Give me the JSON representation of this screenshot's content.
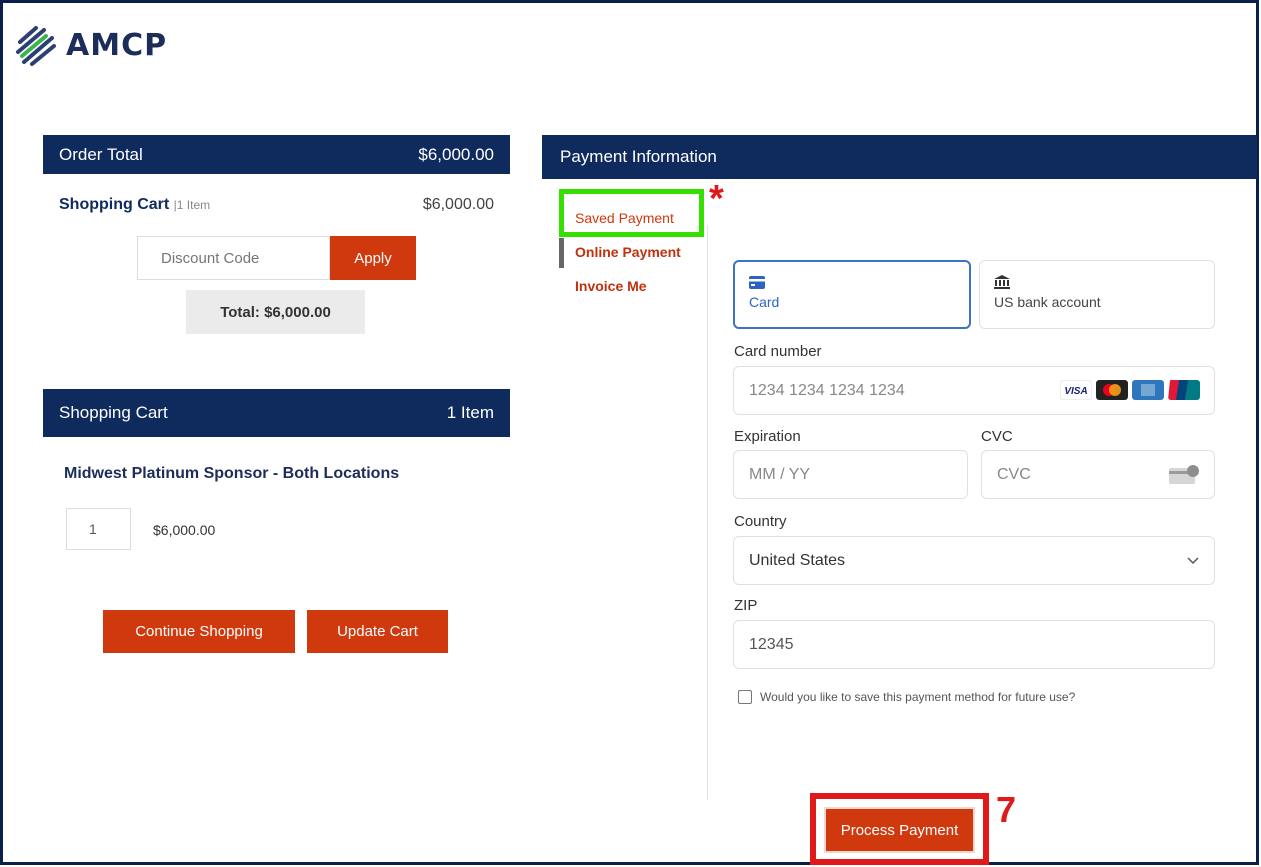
{
  "brand": {
    "logo_text": "AMCP",
    "accent": "#d0380e",
    "navy": "#0f2a5c"
  },
  "order": {
    "header_label": "Order Total",
    "header_amount": "$6,000.00",
    "cart_label": "Shopping Cart",
    "cart_count": "|1 Item",
    "cart_amount": "$6,000.00",
    "discount_placeholder": "Discount Code",
    "apply_label": "Apply",
    "total_label": "Total: $6,000.00"
  },
  "cart": {
    "header_label": "Shopping Cart",
    "header_count": "1 Item",
    "product_name": "Midwest Platinum Sponsor - Both Locations",
    "quantity": "1",
    "price": "$6,000.00",
    "continue_label": "Continue Shopping",
    "update_label": "Update Cart"
  },
  "payment": {
    "header_label": "Payment Information",
    "tabs": [
      {
        "label": "Saved Payment"
      },
      {
        "label": "Online Payment"
      },
      {
        "label": "Invoice Me"
      }
    ],
    "methods": [
      {
        "label": "Card",
        "icon": "credit-card-icon"
      },
      {
        "label": "US bank account",
        "icon": "bank-icon"
      }
    ],
    "card_number_label": "Card number",
    "card_number_placeholder": "1234 1234 1234 1234",
    "card_brands": [
      "visa",
      "mastercard",
      "amex",
      "unionpay"
    ],
    "expiration_label": "Expiration",
    "expiration_placeholder": "MM / YY",
    "cvc_label": "CVC",
    "cvc_placeholder": "CVC",
    "country_label": "Country",
    "country_value": "United States",
    "zip_label": "ZIP",
    "zip_value": "12345",
    "save_label": "Would you like to save this payment method for future use?",
    "process_label": "Process Payment"
  },
  "annotations": {
    "asterisk": "*",
    "step_number": "7",
    "highlight_green": "#35e000",
    "highlight_red": "#e01a1a"
  }
}
